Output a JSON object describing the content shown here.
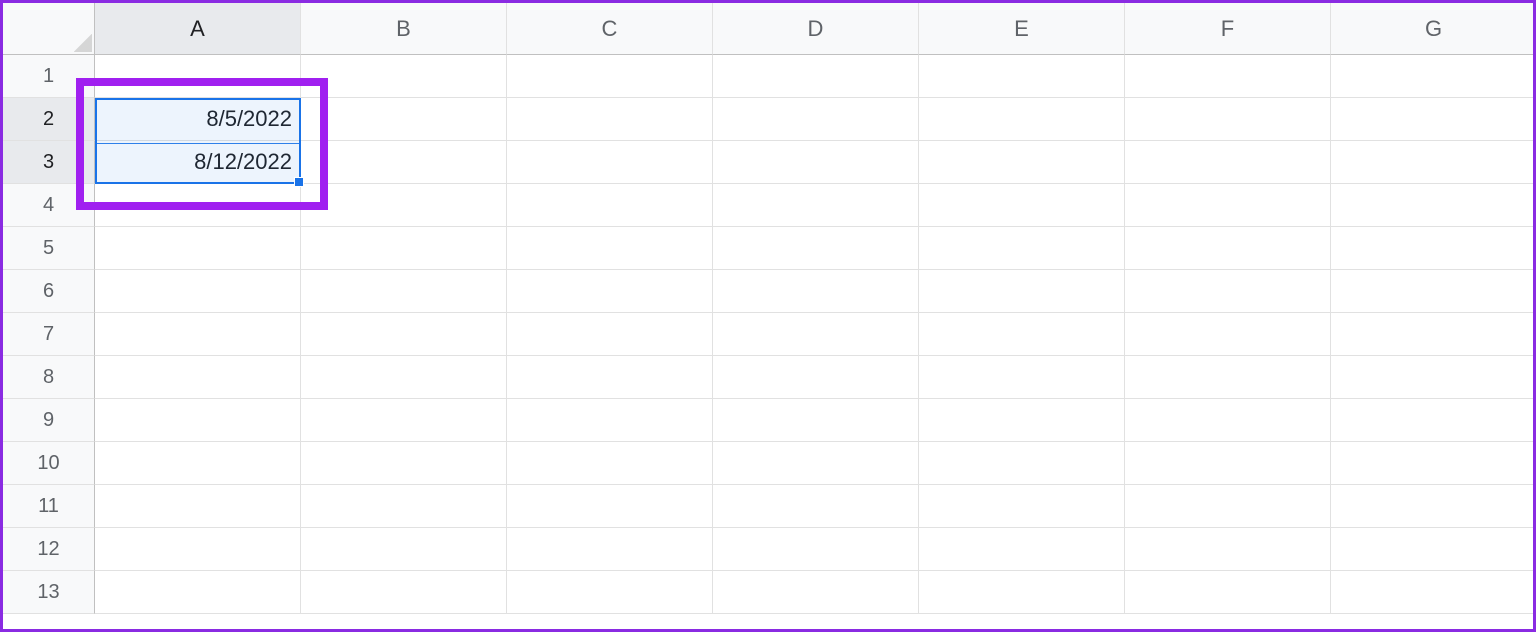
{
  "columns": [
    "A",
    "B",
    "C",
    "D",
    "E",
    "F",
    "G"
  ],
  "rows": [
    "1",
    "2",
    "3",
    "4",
    "5",
    "6",
    "7",
    "8",
    "9",
    "10",
    "11",
    "12",
    "13"
  ],
  "activeCols": [
    "A"
  ],
  "activeRows": [
    "2",
    "3"
  ],
  "cells": {
    "A2": "8/5/2022",
    "A3": "8/12/2022"
  },
  "selection": {
    "startCol": "A",
    "endCol": "A",
    "startRow": "2",
    "endRow": "3"
  },
  "colors": {
    "selectionBorder": "#1a73e8",
    "annotation": "#a020f0"
  }
}
